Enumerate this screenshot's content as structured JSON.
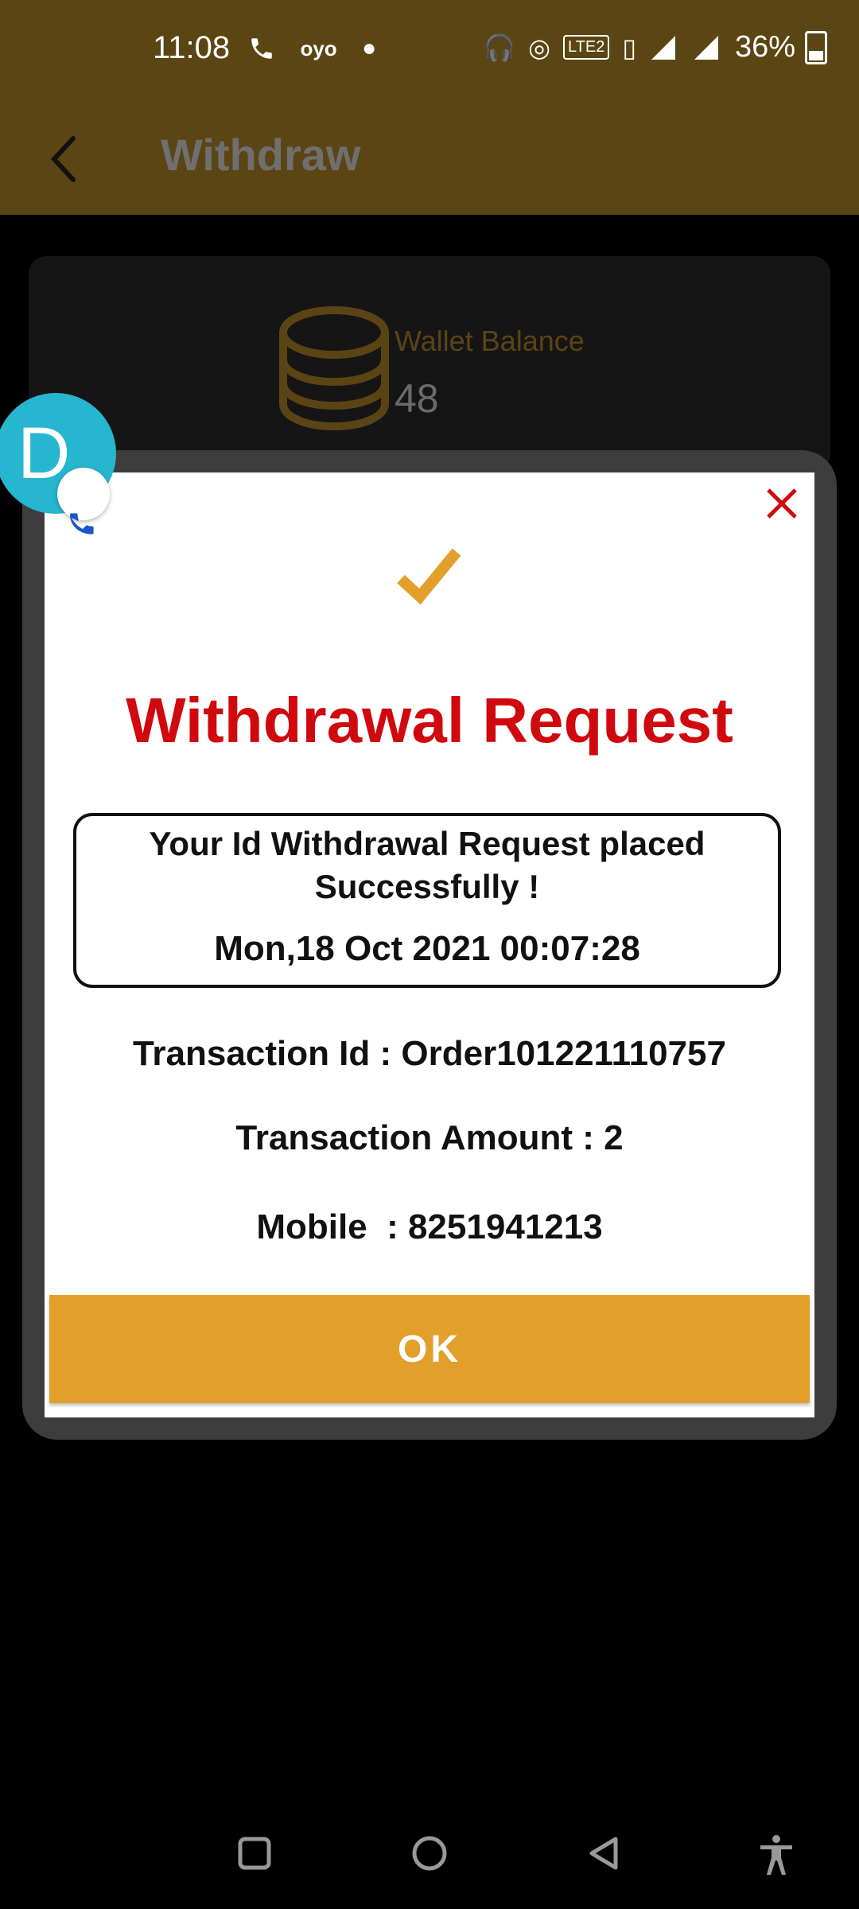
{
  "status_bar": {
    "time": "11:08",
    "left_icons": [
      "phone-icon",
      "oyo-icon",
      "dot-icon"
    ],
    "right_icons": [
      "headphones-icon",
      "hotspot-icon",
      "volte-icon",
      "vibrate-icon",
      "signal-icon",
      "4g-signal-icon"
    ],
    "battery": "36%"
  },
  "app_bar": {
    "title": "Withdraw"
  },
  "wallet": {
    "label": "Wallet Balance",
    "value": "48"
  },
  "dialog": {
    "title": "Withdrawal Request",
    "message": "Your Id Withdrawal Request placed Successfully !",
    "datetime": "Mon,18 Oct 2021 00:07:28",
    "transaction_id": "Transaction Id : Order101221110757",
    "transaction_amount": "Transaction Amount : 2",
    "mobile": "Mobile  : 8251941213",
    "ok_label": "OK"
  },
  "chat_head": {
    "letter": "D"
  },
  "colors": {
    "app_bar": "#5b4512",
    "accent": "#e29f2a",
    "title_red": "#d0090f",
    "bubble": "#27b6cf"
  }
}
